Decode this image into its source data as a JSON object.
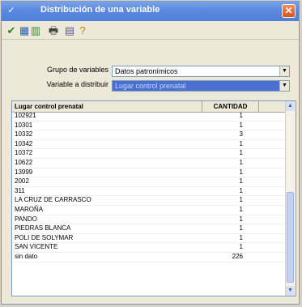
{
  "window": {
    "title": "Distribución de una variable",
    "close_glyph": "✕"
  },
  "toolbar": [
    {
      "name": "check-icon",
      "glyph": "✔",
      "color": "#1e8a1e"
    },
    {
      "name": "table-icon",
      "glyph": "▦",
      "color": "#2e5fb0"
    },
    {
      "name": "chart-icon",
      "glyph": "▥",
      "color": "#3a8a3a"
    },
    {
      "name": "print-icon",
      "glyph": "🖶",
      "color": "#404040"
    },
    {
      "name": "export-icon",
      "glyph": "▤",
      "color": "#5a5a8a"
    },
    {
      "name": "help-icon",
      "glyph": "?",
      "color": "#b08a00"
    }
  ],
  "form": {
    "grupo_label": "Grupo de variables",
    "grupo_value": "Datos patronímicos",
    "variable_label": "Variable a distribuir",
    "variable_value": "Lugar control prenatal"
  },
  "table": {
    "columns": [
      "Lugar control prenatal",
      "CANTIDAD"
    ],
    "rows": [
      [
        "102921",
        "1"
      ],
      [
        "10301",
        "1"
      ],
      [
        "10332",
        "3"
      ],
      [
        "10342",
        "1"
      ],
      [
        "10372",
        "1"
      ],
      [
        "10622",
        "1"
      ],
      [
        "13999",
        "1"
      ],
      [
        "2002",
        "1"
      ],
      [
        "311",
        "1"
      ],
      [
        "LA CRUZ DE CARRASCO",
        "1"
      ],
      [
        "MAROÑA",
        "1"
      ],
      [
        "PANDO",
        "1"
      ],
      [
        "PIEDRAS BLANCA",
        "1"
      ],
      [
        "POLI DE SOLYMAR",
        "1"
      ],
      [
        "SAN VICENTE",
        "1"
      ],
      [
        "sin dato",
        "226"
      ]
    ]
  }
}
